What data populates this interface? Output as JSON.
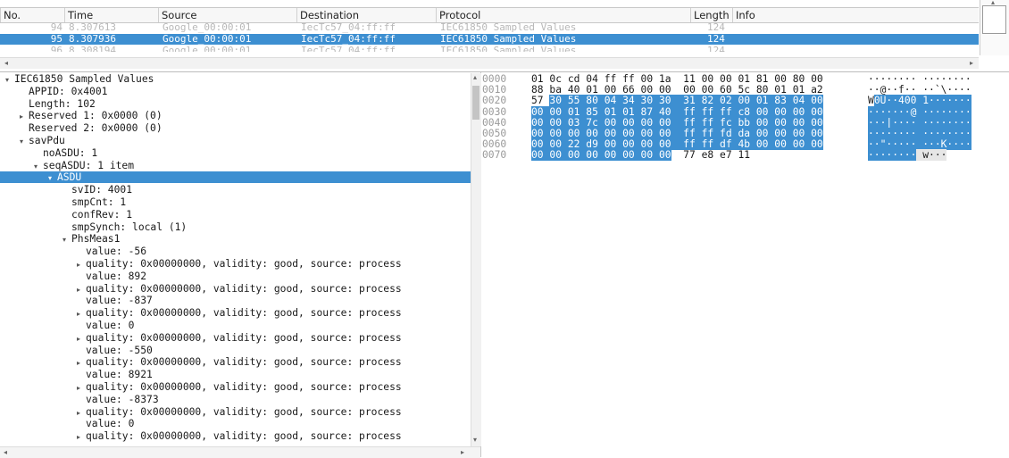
{
  "packet_list": {
    "columns": [
      "No.",
      "Time",
      "Source",
      "Destination",
      "Protocol",
      "Length",
      "Info"
    ],
    "rows": [
      {
        "no": "94",
        "time": "8.307613",
        "source": "Google_00:00:01",
        "destination": "IecTc57_04:ff:ff",
        "protocol": "IEC61850 Sampled Values",
        "length": "124",
        "info": ""
      },
      {
        "no": "95",
        "time": "8.307936",
        "source": "Google_00:00:01",
        "destination": "IecTc57_04:ff:ff",
        "protocol": "IEC61850 Sampled Values",
        "length": "124",
        "info": ""
      },
      {
        "no": "96",
        "time": "8.308194",
        "source": "Google_00:00:01",
        "destination": "IecTc57_04:ff:ff",
        "protocol": "IEC61850 Sampled Values",
        "length": "124",
        "info": ""
      }
    ],
    "selected_row": 1
  },
  "details": {
    "nodes": [
      {
        "toggle": "▾",
        "text": "IEC61850 Sampled Values"
      },
      {
        "toggle": "",
        "text": "APPID: 0x4001"
      },
      {
        "toggle": "",
        "text": "Length: 102"
      },
      {
        "toggle": "▸",
        "text": "Reserved 1: 0x0000 (0)"
      },
      {
        "toggle": "",
        "text": "Reserved 2: 0x0000 (0)"
      },
      {
        "toggle": "▾",
        "text": "savPdu"
      },
      {
        "toggle": "",
        "text": "noASDU: 1"
      },
      {
        "toggle": "▾",
        "text": "seqASDU: 1 item"
      },
      {
        "toggle": "▾",
        "text": "ASDU"
      },
      {
        "toggle": "",
        "text": "svID: 4001"
      },
      {
        "toggle": "",
        "text": "smpCnt: 1"
      },
      {
        "toggle": "",
        "text": "confRev: 1"
      },
      {
        "toggle": "",
        "text": "smpSynch: local (1)"
      },
      {
        "toggle": "▾",
        "text": "PhsMeas1"
      },
      {
        "toggle": "",
        "text": "value: -56"
      },
      {
        "toggle": "▸",
        "text": "quality: 0x00000000, validity: good, source: process"
      },
      {
        "toggle": "",
        "text": "value: 892"
      },
      {
        "toggle": "▸",
        "text": "quality: 0x00000000, validity: good, source: process"
      },
      {
        "toggle": "",
        "text": "value: -837"
      },
      {
        "toggle": "▸",
        "text": "quality: 0x00000000, validity: good, source: process"
      },
      {
        "toggle": "",
        "text": "value: 0"
      },
      {
        "toggle": "▸",
        "text": "quality: 0x00000000, validity: good, source: process"
      },
      {
        "toggle": "",
        "text": "value: -550"
      },
      {
        "toggle": "▸",
        "text": "quality: 0x00000000, validity: good, source: process"
      },
      {
        "toggle": "",
        "text": "value: 8921"
      },
      {
        "toggle": "▸",
        "text": "quality: 0x00000000, validity: good, source: process"
      },
      {
        "toggle": "",
        "text": "value: -8373"
      },
      {
        "toggle": "▸",
        "text": "quality: 0x00000000, validity: good, source: process"
      },
      {
        "toggle": "",
        "text": "value: 0"
      },
      {
        "toggle": "▸",
        "text": "quality: 0x00000000, validity: good, source: process"
      }
    ],
    "selected_node": 8
  },
  "bytes": {
    "rows": [
      {
        "offset": "0000",
        "hex": "01 0c cd 04 ff ff 00 1a  11 00 00 01 81 00 80 00",
        "ascii": "········ ········"
      },
      {
        "offset": "0010",
        "hex": "88 ba 40 01 00 66 00 00  00 00 60 5c 80 01 01 a2",
        "ascii": "··@··f·· ··`\\····"
      },
      {
        "offset": "0020",
        "hex": "57 30 55 80 04 34 30 30  31 82 02 00 01 83 04 00",
        "ascii": "W0U··400 1·······"
      },
      {
        "offset": "0030",
        "hex": "00 00 01 85 01 01 87 40  ff ff ff c8 00 00 00 00",
        "ascii": "·······@ ········"
      },
      {
        "offset": "0040",
        "hex": "00 00 03 7c 00 00 00 00  ff ff fc bb 00 00 00 00",
        "ascii": "···|···· ········"
      },
      {
        "offset": "0050",
        "hex": "00 00 00 00 00 00 00 00  ff ff fd da 00 00 00 00",
        "ascii": "········ ········"
      },
      {
        "offset": "0060",
        "hex": "00 00 22 d9 00 00 00 00  ff ff df 4b 00 00 00 00",
        "ascii": "··\"····· ···K····"
      },
      {
        "offset": "0070",
        "hex": "00 00 00 00 00 00 00 00  77 e8 e7 11",
        "ascii": "········ w···"
      }
    ]
  },
  "colors": {
    "selection": "#3d8fd1",
    "dim_text": "#b8b8b8"
  }
}
